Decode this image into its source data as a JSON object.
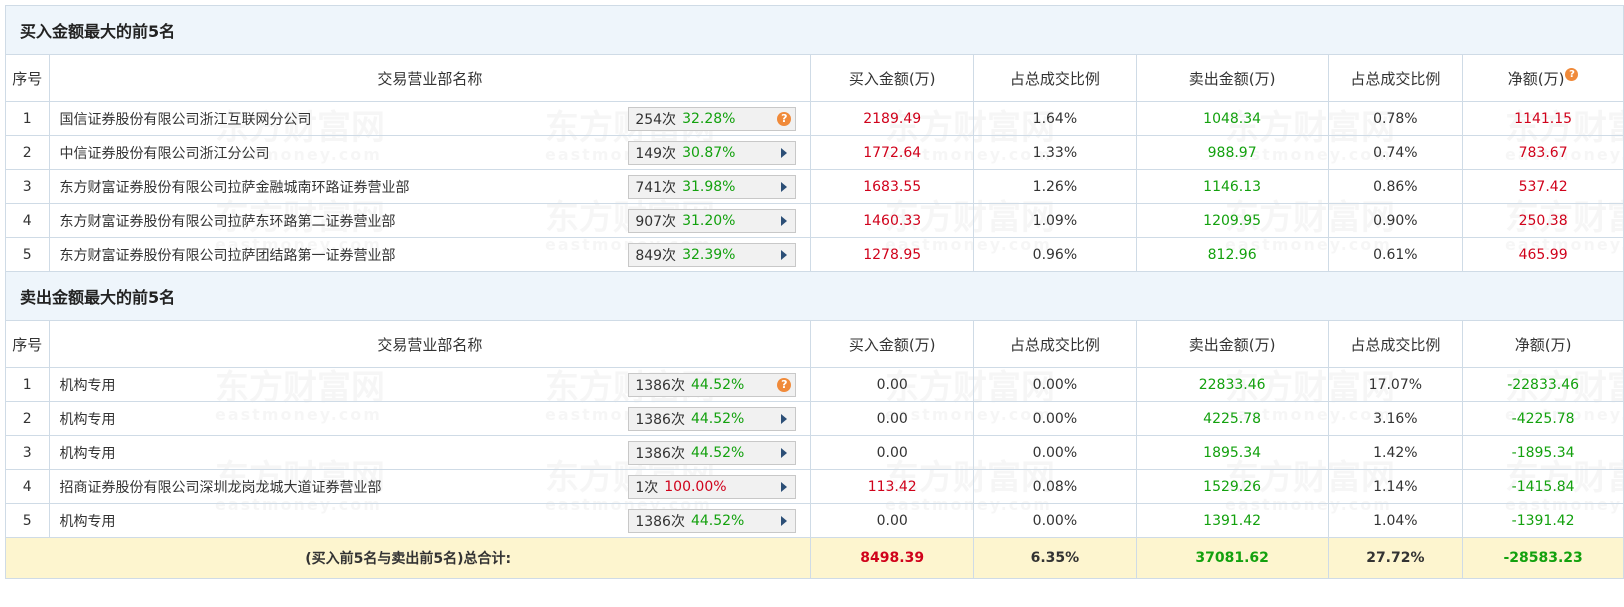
{
  "watermark": {
    "cn": "东方财富网",
    "en": "eastmoney.com"
  },
  "buy_section": {
    "title": "买入金额最大的前5名",
    "headers": [
      "序号",
      "交易营业部名称",
      "买入金额(万)",
      "占总成交比例",
      "卖出金额(万)",
      "占总成交比例",
      "净额(万)"
    ],
    "rows": [
      {
        "no": "1",
        "name": "国信证券股份有限公司浙江互联网分公司",
        "count": "254次",
        "pct": "32.28%",
        "buy": "2189.49",
        "buy_ratio": "1.64%",
        "sell": "1048.34",
        "sell_ratio": "0.78%",
        "net": "1141.15",
        "icon": "question-icon"
      },
      {
        "no": "2",
        "name": "中信证券股份有限公司浙江分公司",
        "count": "149次",
        "pct": "30.87%",
        "buy": "1772.64",
        "buy_ratio": "1.33%",
        "sell": "988.97",
        "sell_ratio": "0.74%",
        "net": "783.67",
        "icon": "play-arrow-icon"
      },
      {
        "no": "3",
        "name": "东方财富证券股份有限公司拉萨金融城南环路证券营业部",
        "count": "741次",
        "pct": "31.98%",
        "buy": "1683.55",
        "buy_ratio": "1.26%",
        "sell": "1146.13",
        "sell_ratio": "0.86%",
        "net": "537.42",
        "icon": "play-arrow-icon"
      },
      {
        "no": "4",
        "name": "东方财富证券股份有限公司拉萨东环路第二证券营业部",
        "count": "907次",
        "pct": "31.20%",
        "buy": "1460.33",
        "buy_ratio": "1.09%",
        "sell": "1209.95",
        "sell_ratio": "0.90%",
        "net": "250.38",
        "icon": "play-arrow-icon"
      },
      {
        "no": "5",
        "name": "东方财富证券股份有限公司拉萨团结路第一证券营业部",
        "count": "849次",
        "pct": "32.39%",
        "buy": "1278.95",
        "buy_ratio": "0.96%",
        "sell": "812.96",
        "sell_ratio": "0.61%",
        "net": "465.99",
        "icon": "play-arrow-icon"
      }
    ]
  },
  "sell_section": {
    "title": "卖出金额最大的前5名",
    "headers": [
      "序号",
      "交易营业部名称",
      "买入金额(万)",
      "占总成交比例",
      "卖出金额(万)",
      "占总成交比例",
      "净额(万)"
    ],
    "rows": [
      {
        "no": "1",
        "name": "机构专用",
        "count": "1386次",
        "pct": "44.52%",
        "buy": "0.00",
        "buy_ratio": "0.00%",
        "sell": "22833.46",
        "sell_ratio": "17.07%",
        "net": "-22833.46",
        "icon": "question-icon"
      },
      {
        "no": "2",
        "name": "机构专用",
        "count": "1386次",
        "pct": "44.52%",
        "buy": "0.00",
        "buy_ratio": "0.00%",
        "sell": "4225.78",
        "sell_ratio": "3.16%",
        "net": "-4225.78",
        "icon": "play-arrow-icon"
      },
      {
        "no": "3",
        "name": "机构专用",
        "count": "1386次",
        "pct": "44.52%",
        "buy": "0.00",
        "buy_ratio": "0.00%",
        "sell": "1895.34",
        "sell_ratio": "1.42%",
        "net": "-1895.34",
        "icon": "play-arrow-icon"
      },
      {
        "no": "4",
        "name": "招商证券股份有限公司深圳龙岗龙城大道证券营业部",
        "count": "1次",
        "pct": "100.00%",
        "buy": "113.42",
        "buy_ratio": "0.08%",
        "sell": "1529.26",
        "sell_ratio": "1.14%",
        "net": "-1415.84",
        "icon": "play-arrow-icon"
      },
      {
        "no": "5",
        "name": "机构专用",
        "count": "1386次",
        "pct": "44.52%",
        "buy": "0.00",
        "buy_ratio": "0.00%",
        "sell": "1391.42",
        "sell_ratio": "1.04%",
        "net": "-1391.42",
        "icon": "play-arrow-icon"
      }
    ]
  },
  "total": {
    "label": "(买入前5名与卖出前5名)总合计:",
    "buy": "8498.39",
    "buy_ratio": "6.35%",
    "sell": "37081.62",
    "sell_ratio": "27.72%",
    "net": "-28583.23"
  },
  "colors": {
    "red": "#d0021b",
    "green": "#13a10e",
    "section_bg": "#eef5fb",
    "total_bg": "#fdf5cf",
    "border": "#cfdbe6",
    "arrow": "#2c4f77",
    "help": "#f08a3a"
  }
}
